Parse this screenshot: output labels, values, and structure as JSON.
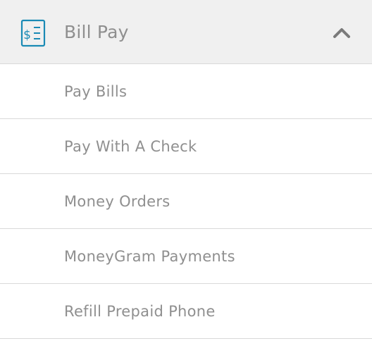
{
  "header": {
    "title": "Bill Pay",
    "icon": "bill-document-icon",
    "toggle_icon": "chevron-up-icon",
    "expanded": true
  },
  "items": [
    {
      "label": "Pay Bills"
    },
    {
      "label": "Pay With A Check"
    },
    {
      "label": "Money Orders"
    },
    {
      "label": "MoneyGram Payments"
    },
    {
      "label": "Refill Prepaid Phone"
    }
  ],
  "colors": {
    "accent": "#1a8ab5",
    "header_bg": "#f0f0f0",
    "text": "#8f8f8f",
    "divider": "#d9d9d9",
    "chevron": "#7a7a7a"
  }
}
